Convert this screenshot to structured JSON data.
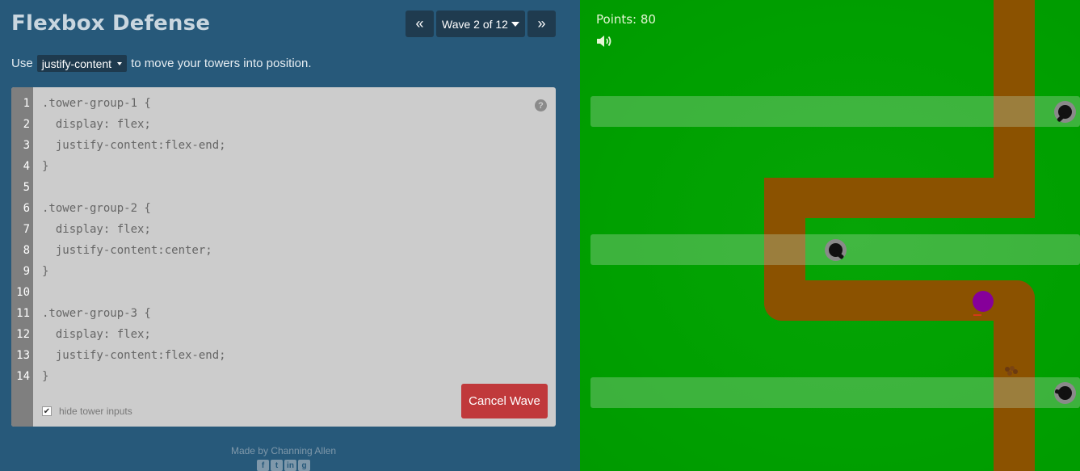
{
  "header": {
    "title": "Flexbox Defense",
    "prev_icon": "double-chevron-left-icon",
    "wave_label": "Wave 2 of 12",
    "next_icon": "double-chevron-right-icon"
  },
  "instructions": {
    "prefix": "Use",
    "property": "justify-content",
    "suffix": "to move your towers into position."
  },
  "editor": {
    "line_numbers": [
      "1",
      "2",
      "3",
      "4",
      "5",
      "6",
      "7",
      "8",
      "9",
      "10",
      "11",
      "12",
      "13",
      "14"
    ],
    "lines": [
      ".tower-group-1 {",
      "  display: flex;",
      "  justify-content:flex-end;",
      "}",
      "",
      ".tower-group-2 {",
      "  display: flex;",
      "  justify-content:center;",
      "}",
      "",
      ".tower-group-3 {",
      "  display: flex;",
      "  justify-content:flex-end;",
      "}"
    ],
    "help_symbol": "?",
    "hide_inputs_label": "hide tower inputs",
    "hide_inputs_checked": true,
    "checkbox_mark": "✔",
    "cancel_label": "Cancel Wave"
  },
  "footer": {
    "credit": "Made by Channing Allen",
    "social": [
      {
        "icon": "facebook-icon",
        "glyph": "f"
      },
      {
        "icon": "twitter-icon",
        "glyph": "t"
      },
      {
        "icon": "linkedin-icon",
        "glyph": "in"
      },
      {
        "icon": "github-icon",
        "glyph": "g"
      }
    ]
  },
  "game": {
    "points_text": "Points: 80",
    "sound_icon": "speaker-icon"
  },
  "colors": {
    "panel": "#27597a",
    "editor_bg": "#cccccc",
    "cancel_button": "#c0393b",
    "grass": "#00a000",
    "path": "#8b5200",
    "enemy": "#86009a"
  }
}
